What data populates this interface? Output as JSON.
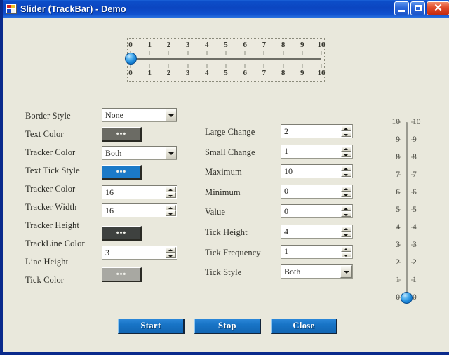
{
  "window": {
    "title": "Slider (TrackBar) - Demo",
    "icon": "app-squares-icon",
    "minimize_label": "",
    "maximize_label": "",
    "close_label": "✕",
    "background_color": "#e9e8dc",
    "titlebar_color": "#0b45c0"
  },
  "horizontal_slider": {
    "min": 0,
    "max": 10,
    "value": 0,
    "tick_labels_top": [
      "0",
      "1",
      "2",
      "3",
      "4",
      "5",
      "6",
      "7",
      "8",
      "9",
      "10"
    ],
    "tick_labels_bottom": [
      "0",
      "1",
      "2",
      "3",
      "4",
      "5",
      "6",
      "7",
      "8",
      "9",
      "10"
    ],
    "thumb_color": "#1b86d8",
    "line_color": "#6e6e66"
  },
  "vertical_slider": {
    "min": 0,
    "max": 10,
    "value": 0,
    "tick_labels_left": [
      "10",
      "9",
      "8",
      "7",
      "6",
      "5",
      "4",
      "3",
      "2",
      "1",
      "0"
    ],
    "tick_labels_right": [
      "10",
      "9",
      "8",
      "7",
      "6",
      "5",
      "4",
      "3",
      "2",
      "1",
      "0"
    ],
    "thumb_color": "#1b86d8",
    "line_color": "#9a9a90"
  },
  "left_column": {
    "labels": [
      "Border Style",
      "Text Color",
      "Tracker Color",
      "Text Tick Style",
      "Tracker Color",
      "Tracker Width",
      "Tracker Height",
      "TrackLine Color",
      "Line Height",
      "Tick Color"
    ],
    "controls": {
      "border_style": {
        "type": "combo",
        "value": "None"
      },
      "text_color": {
        "type": "color",
        "swatch": "#6b6b64"
      },
      "tracker_color_combo": {
        "type": "combo",
        "value": "Both"
      },
      "text_tick_style_color": {
        "type": "color",
        "swatch": "#1b7ac8"
      },
      "tracker_width": {
        "type": "spin",
        "value": "16"
      },
      "tracker_height": {
        "type": "spin",
        "value": "16"
      },
      "trackline_color": {
        "type": "color",
        "swatch": "#3e413f"
      },
      "line_height": {
        "type": "spin",
        "value": "3"
      },
      "tick_color": {
        "type": "color",
        "swatch": "#a8a8a2"
      }
    },
    "color_button_glyph": "•••"
  },
  "middle_column": {
    "rows": [
      {
        "label": "Large Change",
        "type": "spin",
        "value": "2"
      },
      {
        "label": "Small Change",
        "type": "spin",
        "value": "1"
      },
      {
        "label": "Maximum",
        "type": "spin",
        "value": "10"
      },
      {
        "label": "Minimum",
        "type": "spin",
        "value": "0"
      },
      {
        "label": "Value",
        "type": "spin",
        "value": "0"
      },
      {
        "label": "Tick Height",
        "type": "spin",
        "value": "4"
      },
      {
        "label": "Tick Frequency",
        "type": "spin",
        "value": "1"
      },
      {
        "label": "Tick Style",
        "type": "combo",
        "value": "Both"
      }
    ]
  },
  "actions": {
    "start": "Start",
    "stop": "Stop",
    "close": "Close"
  }
}
